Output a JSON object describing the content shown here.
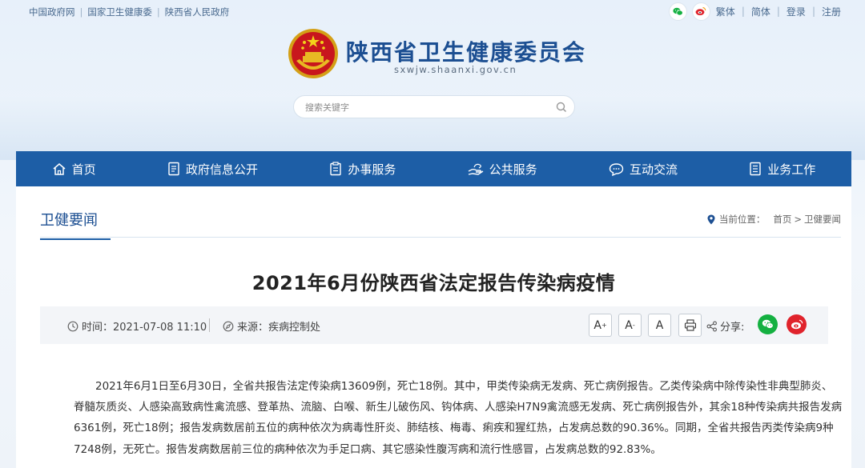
{
  "topbar": {
    "links": [
      "中国政府网",
      "国家卫生健康委",
      "陕西省人民政府"
    ],
    "right": [
      "繁体",
      "简体",
      "登录",
      "注册"
    ]
  },
  "header": {
    "title": "陕西省卫生健康委员会",
    "domain": "sxwjw.shaanxi.gov.cn"
  },
  "search": {
    "placeholder": "搜索关键字"
  },
  "nav": [
    {
      "label": "首页",
      "icon": "home-icon"
    },
    {
      "label": "政府信息公开",
      "icon": "document-icon"
    },
    {
      "label": "办事服务",
      "icon": "clipboard-icon"
    },
    {
      "label": "公共服务",
      "icon": "hand-service-icon"
    },
    {
      "label": "互动交流",
      "icon": "chat-icon"
    },
    {
      "label": "业务工作",
      "icon": "list-icon"
    }
  ],
  "section": {
    "title": "卫健要闻",
    "crumb_label": "当前位置：",
    "crumb_home": "首页",
    "crumb_sep": ">",
    "crumb_current": "卫健要闻"
  },
  "article": {
    "title": "2021年6月份陕西省法定报告传染病疫情",
    "time": "时间：2021-07-08 11:10",
    "source": "来源：疾病控制处",
    "font_large": "A",
    "font_large_sup": "+",
    "font_small": "A",
    "font_small_sup": "-",
    "font_default": "A",
    "share_label": "分享:",
    "body": "2021年6月1日至6月30日，全省共报告法定传染病13609例，死亡18例。其中，甲类传染病无发病、死亡病例报告。乙类传染病中除传染性非典型肺炎、脊髓灰质炎、人感染高致病性禽流感、登革热、流脑、白喉、新生儿破伤风、钩体病、人感染H7N9禽流感无发病、死亡病例报告外，其余18种传染病共报告发病6361例，死亡18例；报告发病数居前五位的病种依次为病毒性肝炎、肺结核、梅毒、痢疾和猩红热，占发病总数的90.36%。同期，全省共报告丙类传染病9种7248例，无死亡。报告发病数居前三位的病种依次为手足口病、其它感染性腹泻病和流行性感冒，占发病总数的92.83%。"
  },
  "colors": {
    "nav_bg": "#1d5ea6",
    "title_blue": "#1c4f92",
    "wechat_green": "#14b041",
    "weibo_red": "#e0232c"
  }
}
